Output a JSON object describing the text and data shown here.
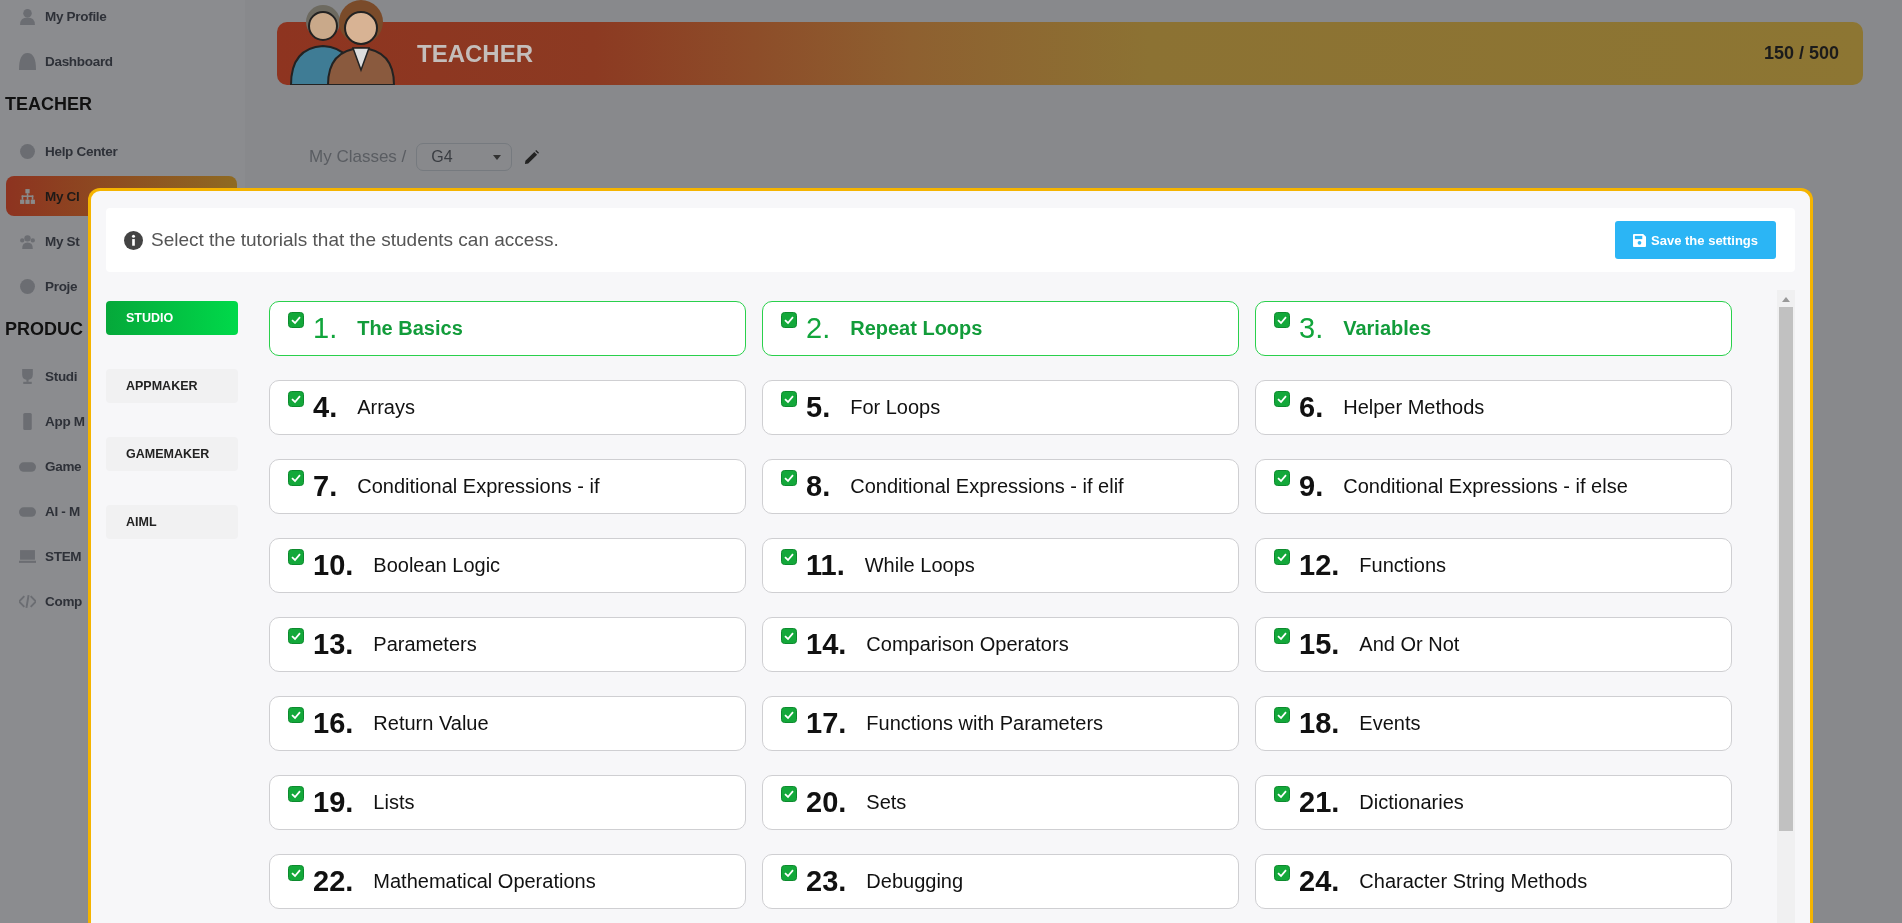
{
  "sidebar": {
    "entries": [
      {
        "kind": "item",
        "label": "My Profile",
        "selected": false
      },
      {
        "kind": "item",
        "label": "Dashboard",
        "selected": false
      },
      {
        "kind": "heading",
        "label": "TEACHER"
      },
      {
        "kind": "item",
        "label": "Help Center",
        "selected": false
      },
      {
        "kind": "item",
        "label": "My Cl",
        "selected": true
      },
      {
        "kind": "item",
        "label": "My St",
        "selected": false
      },
      {
        "kind": "item",
        "label": "Proje",
        "selected": false
      },
      {
        "kind": "heading",
        "label": "PRODUC"
      },
      {
        "kind": "item",
        "label": "Studi",
        "selected": false
      },
      {
        "kind": "item",
        "label": "App M",
        "selected": false
      },
      {
        "kind": "item",
        "label": "Game",
        "selected": false
      },
      {
        "kind": "item",
        "label": "AI - M",
        "selected": false
      },
      {
        "kind": "item",
        "label": "STEM",
        "selected": false
      },
      {
        "kind": "item",
        "label": "Comp",
        "selected": false
      }
    ]
  },
  "banner": {
    "title": "TEACHER",
    "score": "150 / 500"
  },
  "breadcrumb": {
    "label": "My Classes /",
    "class_select": "G4"
  },
  "modal": {
    "info": "Select the tutorials that the students can access.",
    "save_button": "Save the settings",
    "tabs": [
      {
        "label": "STUDIO",
        "selected": true
      },
      {
        "label": "APPMAKER",
        "selected": false
      },
      {
        "label": "GAMEMAKER",
        "selected": false
      },
      {
        "label": "AIML",
        "selected": false
      }
    ],
    "tutorials": [
      {
        "number": "1.",
        "title": "The Basics",
        "checked": true,
        "selected": true
      },
      {
        "number": "2.",
        "title": "Repeat Loops",
        "checked": true,
        "selected": true
      },
      {
        "number": "3.",
        "title": "Variables",
        "checked": true,
        "selected": true
      },
      {
        "number": "4.",
        "title": "Arrays",
        "checked": true,
        "selected": false
      },
      {
        "number": "5.",
        "title": "For Loops",
        "checked": true,
        "selected": false
      },
      {
        "number": "6.",
        "title": "Helper Methods",
        "checked": true,
        "selected": false
      },
      {
        "number": "7.",
        "title": "Conditional Expressions - if",
        "checked": true,
        "selected": false
      },
      {
        "number": "8.",
        "title": "Conditional Expressions - if elif",
        "checked": true,
        "selected": false
      },
      {
        "number": "9.",
        "title": "Conditional Expressions - if else",
        "checked": true,
        "selected": false
      },
      {
        "number": "10.",
        "title": "Boolean Logic",
        "checked": true,
        "selected": false
      },
      {
        "number": "11.",
        "title": "While Loops",
        "checked": true,
        "selected": false
      },
      {
        "number": "12.",
        "title": "Functions",
        "checked": true,
        "selected": false
      },
      {
        "number": "13.",
        "title": "Parameters",
        "checked": true,
        "selected": false
      },
      {
        "number": "14.",
        "title": "Comparison Operators",
        "checked": true,
        "selected": false
      },
      {
        "number": "15.",
        "title": "And Or Not",
        "checked": true,
        "selected": false
      },
      {
        "number": "16.",
        "title": "Return Value",
        "checked": true,
        "selected": false
      },
      {
        "number": "17.",
        "title": "Functions with Parameters",
        "checked": true,
        "selected": false
      },
      {
        "number": "18.",
        "title": "Events",
        "checked": true,
        "selected": false
      },
      {
        "number": "19.",
        "title": "Lists",
        "checked": true,
        "selected": false
      },
      {
        "number": "20.",
        "title": "Sets",
        "checked": true,
        "selected": false
      },
      {
        "number": "21.",
        "title": "Dictionaries",
        "checked": true,
        "selected": false
      },
      {
        "number": "22.",
        "title": "Mathematical Operations",
        "checked": true,
        "selected": false
      },
      {
        "number": "23.",
        "title": "Debugging",
        "checked": true,
        "selected": false
      },
      {
        "number": "24.",
        "title": "Character String Methods",
        "checked": true,
        "selected": false
      }
    ]
  }
}
